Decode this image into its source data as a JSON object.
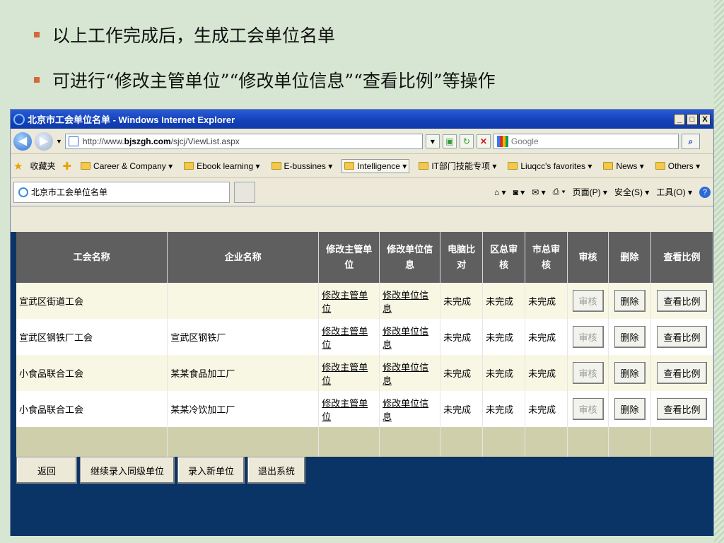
{
  "bullets": [
    "以上工作完成后，生成工会单位名单",
    "可进行“修改主管单位”“修改单位信息”“查看比例”等操作"
  ],
  "window": {
    "title": "北京市工会单位名单 - Windows Internet Explorer",
    "controls": [
      "_",
      "□",
      "X"
    ]
  },
  "address": {
    "prefix": "http://www.",
    "domain": "bjszgh.com",
    "path": "/sjcj/ViewList.aspx",
    "search_placeholder": "Google"
  },
  "favorites": {
    "label": "收藏夹",
    "items": [
      "Career & Company ▾",
      "Ebook learning ▾",
      "E-bussines ▾",
      "Intelligence ▾",
      "IT部门技能专项 ▾",
      "Liuqcc's favorites ▾",
      "News ▾",
      "Others ▾"
    ]
  },
  "tab": {
    "title": "北京市工会单位名单"
  },
  "commands": [
    "页面(P) ▾",
    "安全(S) ▾",
    "工具(O) ▾"
  ],
  "table": {
    "headers": [
      "工会名称",
      "企业名称",
      "修改主管单\n位",
      "修改单位信\n息",
      "电脑比\n对",
      "区总审\n核",
      "市总审\n核",
      "审核",
      "删除",
      "查看比例"
    ],
    "rows": [
      {
        "union": "宣武区街道工会",
        "company": "",
        "link1": "修改主管单位",
        "link2": "修改单位信息",
        "s1": "未完成",
        "s2": "未完成",
        "s3": "未完成",
        "b1": "审核",
        "b2": "删除",
        "b3": "查看比例"
      },
      {
        "union": "宣武区钢铁厂工会",
        "company": "宣武区钢铁厂",
        "link1": "修改主管单位",
        "link2": "修改单位信息",
        "s1": "未完成",
        "s2": "未完成",
        "s3": "未完成",
        "b1": "审核",
        "b2": "删除",
        "b3": "查看比例"
      },
      {
        "union": "小食品联合工会",
        "company": "某某食品加工厂",
        "link1": "修改主管单位",
        "link2": "修改单位信息",
        "s1": "未完成",
        "s2": "未完成",
        "s3": "未完成",
        "b1": "审核",
        "b2": "删除",
        "b3": "查看比例"
      },
      {
        "union": "小食品联合工会",
        "company": "某某冷饮加工厂",
        "link1": "修改主管单位",
        "link2": "修改单位信息",
        "s1": "未完成",
        "s2": "未完成",
        "s3": "未完成",
        "b1": "审核",
        "b2": "删除",
        "b3": "查看比例"
      }
    ]
  },
  "bottom_buttons": [
    "返回",
    "继续录入同级单位",
    "录入新单位",
    "退出系统"
  ],
  "colors": {
    "header_bg": "#5f5f5f",
    "content_bg": "#0b3466",
    "bullet": "#d5693a",
    "slide_bg": "#d6e6d2"
  }
}
